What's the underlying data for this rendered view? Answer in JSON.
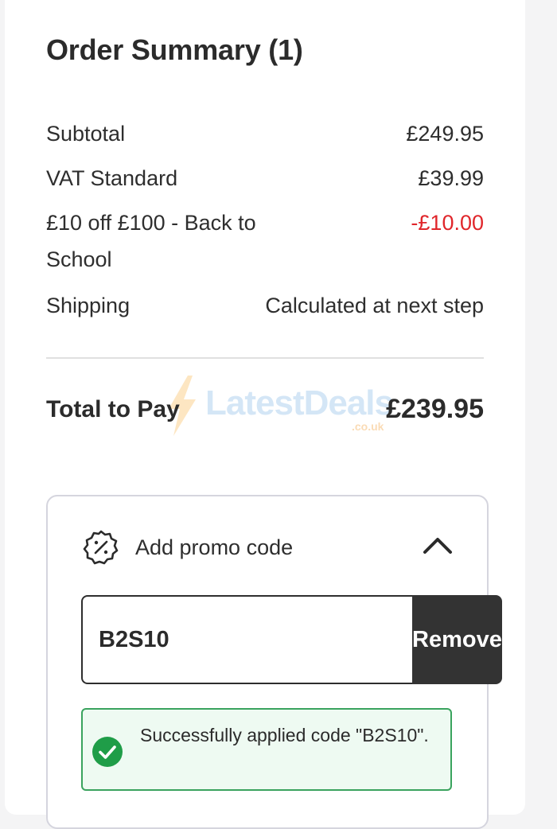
{
  "order_summary": {
    "title": "Order Summary (1)",
    "rows": {
      "subtotal": {
        "label": "Subtotal",
        "value": "£249.95"
      },
      "vat": {
        "label": "VAT Standard",
        "value": "£39.99"
      },
      "discount": {
        "label": "£10 off £100 - Back to School",
        "value": "-£10.00"
      },
      "shipping": {
        "label": "Shipping",
        "value": "Calculated at next step"
      }
    },
    "total": {
      "label": "Total to Pay",
      "value": "£239.95"
    }
  },
  "watermark": {
    "text": "LatestDeals",
    "sub": ".co.uk"
  },
  "promo": {
    "icon": "discount-badge-icon",
    "label": "Add promo code",
    "expanded": true,
    "input_value": "B2S10",
    "button_label": "Remove",
    "success_message": "Successfully applied code \"B2S10\"."
  },
  "colors": {
    "discount_red": "#e0262b",
    "success_green": "#1f9d48",
    "button_dark": "#333333"
  }
}
